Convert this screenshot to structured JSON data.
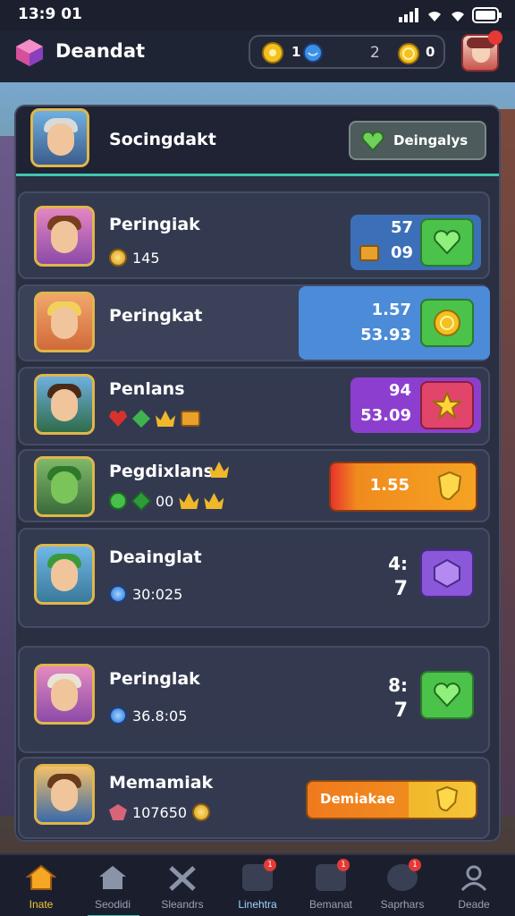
{
  "status": {
    "time": "13:9 01"
  },
  "app": {
    "title": "Deandat"
  },
  "currency": {
    "gold": "1",
    "gems": "2",
    "coins": "0"
  },
  "panel": {
    "title": "Socingdakt",
    "button": "Deingalys"
  },
  "players": [
    {
      "name": "Peringiak",
      "stat": "145",
      "values": [
        "57",
        "09"
      ],
      "action": "heart",
      "box_color": "#3b6fb7",
      "btn_color": "#4bc24a"
    },
    {
      "name": "Peringkat",
      "stat": "",
      "values": [
        "1.57",
        "53.93"
      ],
      "action": "coin",
      "box_color": "#4b8bd8",
      "btn_color": "#4bc24a"
    },
    {
      "name": "Penlans",
      "stat": "",
      "values": [
        "94",
        "53.09"
      ],
      "action": "star",
      "box_color": "#8c3fcf",
      "btn_color": "#e2456a"
    },
    {
      "name": "Pegdixlans",
      "stat": "00",
      "values": [
        "1.55"
      ],
      "action": "shield",
      "box_color": "#f08b1e",
      "btn_color": "#f0a21e"
    },
    {
      "name": "Deainglat",
      "stat": "30:025",
      "values": [
        "4:",
        "7"
      ],
      "action": "gem",
      "box_color": "",
      "btn_color": "#8a58d8"
    },
    {
      "name": "Peringlak",
      "stat": "36.8:05",
      "values": [
        "8:",
        "7"
      ],
      "action": "heart",
      "box_color": "",
      "btn_color": "#4bc24a"
    },
    {
      "name": "Memamiak",
      "stat": "107650",
      "button": "Demiakae",
      "action": "shield",
      "box_color": "#f08b1e",
      "btn_color": "#f0b72a"
    }
  ],
  "nav": [
    {
      "label": "Inate",
      "active": true
    },
    {
      "label": "Seodidi",
      "active": false
    },
    {
      "label": "Sleandrs",
      "active": false
    },
    {
      "label": "Linehtra",
      "active": false,
      "badge": "1"
    },
    {
      "label": "Bemanat",
      "active": false,
      "badge": "1"
    },
    {
      "label": "Saprhars",
      "active": false,
      "badge": "1"
    },
    {
      "label": "Deade",
      "active": false
    }
  ]
}
